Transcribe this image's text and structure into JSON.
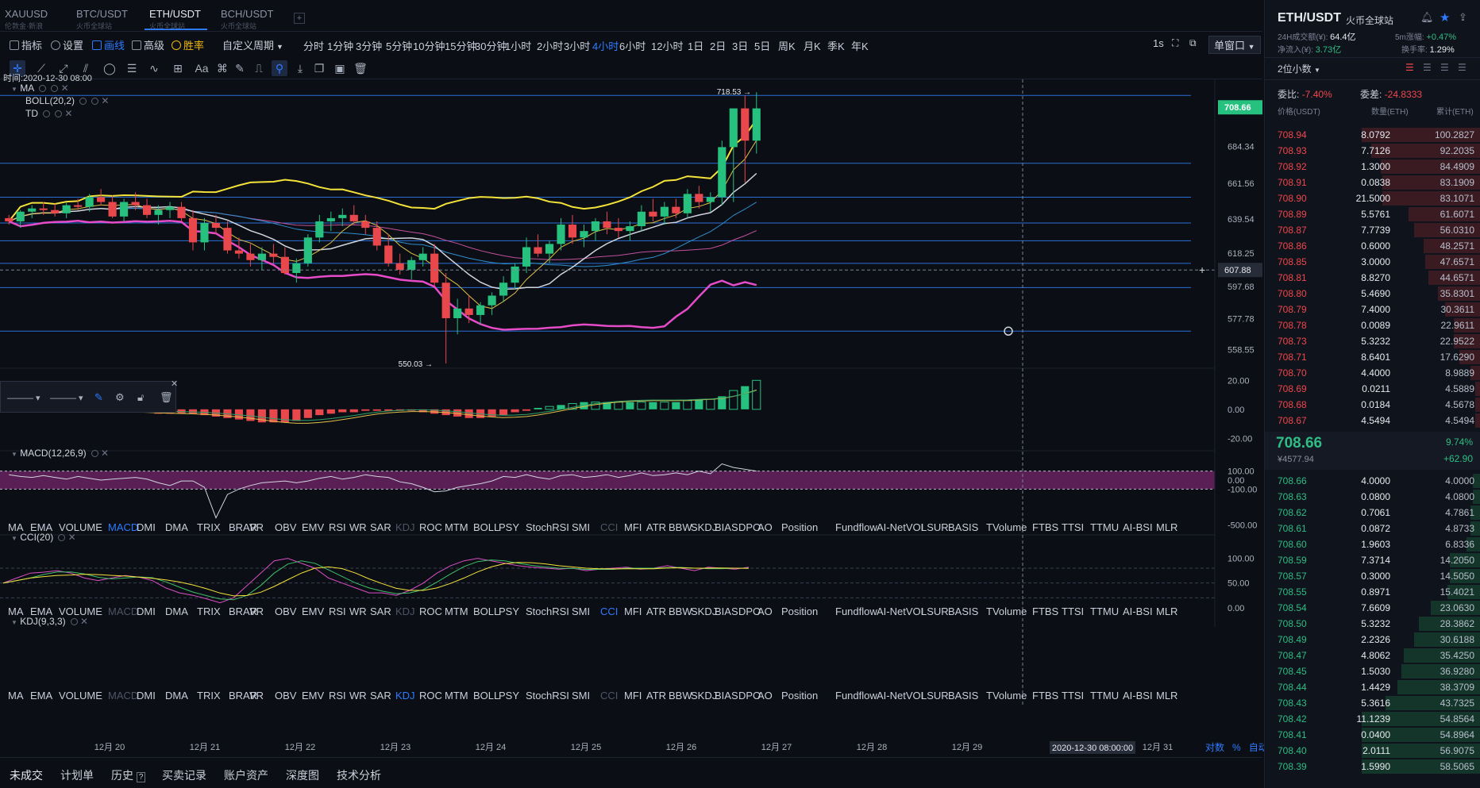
{
  "tabs": [
    {
      "symbol": "XAUUSD",
      "sub": "伦敦金·新浪"
    },
    {
      "symbol": "BTC/USDT",
      "sub": "火币全球站"
    },
    {
      "symbol": "ETH/USDT",
      "sub": "火币全球站"
    },
    {
      "symbol": "BCH/USDT",
      "sub": "火币全球站"
    }
  ],
  "active_tab": 2,
  "toolbar": {
    "items": [
      "指标",
      "设置",
      "画线",
      "高级",
      "胜率"
    ],
    "custom_period": "自定义周期",
    "periods": [
      "分时",
      "1分钟",
      "3分钟",
      "5分钟",
      "10分钟",
      "15分钟",
      "30分钟",
      "1小时",
      "2小时",
      "3小时",
      "4小时",
      "6小时",
      "12小时",
      "1日",
      "2日",
      "3日",
      "5日",
      "周K",
      "月K",
      "季K",
      "年K"
    ],
    "active_period": "4小时",
    "interval": "1s",
    "window_mode": "单窗口"
  },
  "drawing_tools": [
    "crosshair",
    "line-icon",
    "ray-icon",
    "parallel-icon",
    "ellipse-icon",
    "fib-icon",
    "wave-icon",
    "grid-icon",
    "text-icon",
    "brush-icon",
    "ruler-icon",
    "magnet-icon",
    "measure-icon",
    "lock-icon",
    "copy-icon",
    "screenshot-icon",
    "trash-icon"
  ],
  "crosshair_time": "时间:2020-12-30 08:00",
  "main_legends": [
    "MA",
    "BOLL(20,2)",
    "TD"
  ],
  "macd_legend": "MACD(12,26,9)",
  "cci_legend": "CCI(20)",
  "kdj_legend": "KDJ(9,3,3)",
  "indicator_list": [
    "MA",
    "EMA",
    "VOLUME",
    "MACD",
    "DMI",
    "DMA",
    "TRIX",
    "BRAR",
    "VR",
    "OBV",
    "EMV",
    "RSI",
    "WR",
    "SAR",
    "KDJ",
    "ROC",
    "MTM",
    "BOLL",
    "PSY",
    "StochRSI",
    "SMI",
    "CCI",
    "MFI",
    "ATR",
    "BBW",
    "SKDJ",
    "BIAS",
    "DPO",
    "AO",
    "Position",
    "Fundflow",
    "AI-NetVOL",
    "LSUR",
    "BASIS",
    "TVolume",
    "FTBS",
    "TTSI",
    "TTMU",
    "AI-BSI",
    "MLR"
  ],
  "bottom_tabs": [
    "未成交",
    "计划单",
    "历史",
    "买卖记录",
    "账户资产",
    "深度图",
    "技术分析"
  ],
  "axis_modes": [
    "对数",
    "%",
    "自动"
  ],
  "chart_data": [
    {
      "type": "candlestick",
      "name": "ETH/USDT 4小时",
      "x_labels": [
        "12月 20",
        "12月 21",
        "12月 22",
        "12月 23",
        "12月 24",
        "12月 25",
        "12月 26",
        "12月 27",
        "12月 28",
        "12月 29",
        "12月 30",
        "12月 31"
      ],
      "crosshair_x_label": "2020-12-30 08:00:00",
      "y_ticks": [
        708.66,
        684.34,
        661.56,
        639.54,
        618.25,
        597.68,
        577.78,
        558.55
      ],
      "ylim": [
        548,
        725
      ],
      "last_price": 708.66,
      "crosshair_price": 607.88,
      "annotations": [
        {
          "label": "718.53",
          "value": 718.53
        },
        {
          "label": "550.03",
          "value": 550.03
        }
      ],
      "horizontal_levels": [
        716,
        674,
        653,
        637,
        626,
        612,
        597,
        570
      ],
      "ohlc": [
        [
          640,
          642,
          636,
          638
        ],
        [
          638,
          645,
          634,
          644
        ],
        [
          644,
          648,
          640,
          646
        ],
        [
          646,
          650,
          642,
          645
        ],
        [
          645,
          649,
          641,
          643
        ],
        [
          643,
          650,
          640,
          648
        ],
        [
          648,
          652,
          645,
          647
        ],
        [
          647,
          655,
          644,
          653
        ],
        [
          653,
          658,
          648,
          650
        ],
        [
          650,
          654,
          640,
          641
        ],
        [
          641,
          652,
          638,
          650
        ],
        [
          650,
          656,
          645,
          648
        ],
        [
          648,
          652,
          640,
          642
        ],
        [
          642,
          648,
          636,
          645
        ],
        [
          645,
          650,
          640,
          647
        ],
        [
          647,
          650,
          638,
          640
        ],
        [
          640,
          645,
          620,
          625
        ],
        [
          625,
          640,
          620,
          637
        ],
        [
          637,
          642,
          630,
          634
        ],
        [
          634,
          638,
          618,
          620
        ],
        [
          620,
          628,
          615,
          618
        ],
        [
          618,
          624,
          610,
          614
        ],
        [
          614,
          622,
          608,
          618
        ],
        [
          618,
          624,
          612,
          616
        ],
        [
          616,
          622,
          605,
          606
        ],
        [
          606,
          615,
          600,
          612
        ],
        [
          612,
          630,
          610,
          628
        ],
        [
          628,
          642,
          625,
          638
        ],
        [
          638,
          644,
          632,
          640
        ],
        [
          640,
          646,
          635,
          642
        ],
        [
          642,
          648,
          636,
          638
        ],
        [
          638,
          642,
          630,
          634
        ],
        [
          634,
          638,
          620,
          623
        ],
        [
          623,
          630,
          610,
          612
        ],
        [
          612,
          618,
          605,
          608
        ],
        [
          608,
          616,
          602,
          614
        ],
        [
          614,
          622,
          610,
          618
        ],
        [
          618,
          624,
          598,
          600
        ],
        [
          600,
          606,
          550,
          578
        ],
        [
          578,
          590,
          568,
          584
        ],
        [
          584,
          592,
          575,
          580
        ],
        [
          580,
          588,
          574,
          586
        ],
        [
          586,
          594,
          580,
          592
        ],
        [
          592,
          604,
          588,
          600
        ],
        [
          600,
          612,
          596,
          610
        ],
        [
          610,
          628,
          606,
          622
        ],
        [
          622,
          630,
          616,
          618
        ],
        [
          618,
          626,
          612,
          624
        ],
        [
          624,
          640,
          620,
          636
        ],
        [
          636,
          642,
          624,
          628
        ],
        [
          628,
          636,
          622,
          632
        ],
        [
          632,
          640,
          626,
          638
        ],
        [
          638,
          644,
          630,
          634
        ],
        [
          634,
          640,
          628,
          632
        ],
        [
          632,
          638,
          626,
          635
        ],
        [
          635,
          648,
          632,
          644
        ],
        [
          644,
          652,
          638,
          641
        ],
        [
          641,
          650,
          636,
          647
        ],
        [
          647,
          652,
          640,
          643
        ],
        [
          643,
          658,
          640,
          655
        ],
        [
          655,
          660,
          646,
          650
        ],
        [
          650,
          656,
          644,
          653
        ],
        [
          653,
          688,
          648,
          684
        ],
        [
          684,
          702,
          650,
          708
        ],
        [
          708,
          716,
          662,
          688
        ],
        [
          688,
          718,
          680,
          708
        ]
      ]
    },
    {
      "type": "bar",
      "name": "MACD(12,26,9)",
      "y_ticks": [
        20.0,
        0.0,
        -20.0
      ],
      "ylim": [
        -22,
        24
      ],
      "histogram": [
        -1,
        -1,
        -1,
        -1,
        -1,
        -1,
        -1,
        -1,
        -2,
        -2,
        -2,
        -2,
        -2,
        -3,
        -3,
        -3,
        -3,
        -4,
        -5,
        -6,
        -7,
        -8,
        -9,
        -9,
        -9,
        -8,
        -6,
        -4,
        -3,
        -2,
        -2,
        -1,
        -1,
        -1,
        -1,
        -1,
        -2,
        -3,
        -4,
        -5,
        -6,
        -6,
        -5,
        -4,
        -2,
        -1,
        1,
        2,
        3,
        4,
        5,
        5,
        5,
        5,
        5,
        5,
        5,
        5,
        5,
        6,
        7,
        7,
        9,
        13,
        16,
        20
      ]
    },
    {
      "type": "line",
      "name": "CCI(20)",
      "y_ticks": [
        100.0,
        0.0,
        -100.0,
        -500.0
      ],
      "ylim": [
        -520,
        220
      ],
      "values": [
        60,
        40,
        30,
        50,
        30,
        10,
        40,
        20,
        0,
        10,
        20,
        30,
        10,
        -30,
        -60,
        -10,
        -10,
        -80,
        -420,
        -160,
        -100,
        -60,
        -30,
        -20,
        -10,
        -30,
        -10,
        20,
        40,
        10,
        30,
        60,
        40,
        30,
        -20,
        -40,
        -80,
        -130,
        -120,
        -80,
        -60,
        -40,
        -10,
        40,
        30,
        60,
        30,
        10,
        50,
        60,
        30,
        40,
        60,
        30,
        50,
        80,
        50,
        60,
        80,
        60,
        100,
        70,
        180,
        140,
        120,
        100
      ]
    },
    {
      "type": "line",
      "name": "KDJ(9,3,3)",
      "y_ticks": [
        100.0,
        50.0,
        0.0
      ],
      "ylim": [
        -10,
        125
      ],
      "values": [
        50,
        60,
        70,
        72,
        75,
        70,
        60,
        55,
        60,
        65,
        62,
        55,
        40,
        30,
        25,
        18,
        10,
        20,
        45,
        70,
        95,
        100,
        90,
        80,
        60,
        50,
        40,
        30,
        30,
        25,
        35,
        50,
        70,
        85,
        95,
        100,
        95,
        90,
        85,
        82,
        80,
        78,
        80,
        75,
        78,
        80,
        82,
        78,
        80,
        85,
        80,
        75,
        82,
        80,
        78,
        82
      ]
    }
  ],
  "right": {
    "symbol": "ETH/USDT",
    "exchange": "火币全球站",
    "vol_label": "24H成交额(¥):",
    "vol_value": "64.4亿",
    "chg5m_label": "5m涨幅:",
    "chg5m_value": "+0.47%",
    "netin_label": "净流入(¥):",
    "netin_value": "3.73亿",
    "turnover_label": "换手率:",
    "turnover_value": "1.29%",
    "precision": "2位小数",
    "ratio_label": "委比:",
    "ratio_value": "-7.40%",
    "diff_label": "委差:",
    "diff_value": "-24.8333",
    "col_price": "价格(USDT)",
    "col_qty": "数量(ETH)",
    "col_cum": "累计(ETH)",
    "asks": [
      {
        "p": "708.94",
        "q": "8.0792",
        "c": "100.2827",
        "d": 1.0
      },
      {
        "p": "708.93",
        "q": "7.7126",
        "c": "92.2035",
        "d": 0.92
      },
      {
        "p": "708.92",
        "q": "1.3000",
        "c": "84.4909",
        "d": 0.84
      },
      {
        "p": "708.91",
        "q": "0.0838",
        "c": "83.1909",
        "d": 0.83
      },
      {
        "p": "708.90",
        "q": "21.5000",
        "c": "83.1071",
        "d": 0.83
      },
      {
        "p": "708.89",
        "q": "5.5761",
        "c": "61.6071",
        "d": 0.61
      },
      {
        "p": "708.87",
        "q": "7.7739",
        "c": "56.0310",
        "d": 0.56
      },
      {
        "p": "708.86",
        "q": "0.6000",
        "c": "48.2571",
        "d": 0.48
      },
      {
        "p": "708.85",
        "q": "3.0000",
        "c": "47.6571",
        "d": 0.47
      },
      {
        "p": "708.81",
        "q": "8.8270",
        "c": "44.6571",
        "d": 0.44
      },
      {
        "p": "708.80",
        "q": "5.4690",
        "c": "35.8301",
        "d": 0.36
      },
      {
        "p": "708.79",
        "q": "7.4000",
        "c": "30.3611",
        "d": 0.3
      },
      {
        "p": "708.78",
        "q": "0.0089",
        "c": "22.9611",
        "d": 0.23
      },
      {
        "p": "708.73",
        "q": "5.3232",
        "c": "22.9522",
        "d": 0.23
      },
      {
        "p": "708.71",
        "q": "8.6401",
        "c": "17.6290",
        "d": 0.18
      },
      {
        "p": "708.70",
        "q": "4.4000",
        "c": "8.9889",
        "d": 0.09
      },
      {
        "p": "708.69",
        "q": "0.0211",
        "c": "4.5889",
        "d": 0.05
      },
      {
        "p": "708.68",
        "q": "0.0184",
        "c": "4.5678",
        "d": 0.05
      },
      {
        "p": "708.67",
        "q": "4.5494",
        "c": "4.5494",
        "d": 0.05
      }
    ],
    "last": "708.66",
    "last_cny": "¥4577.94",
    "last_pct": "9.74%",
    "last_chg": "+62.90",
    "bids": [
      {
        "p": "708.66",
        "q": "4.0000",
        "c": "4.0000",
        "d": 0.07
      },
      {
        "p": "708.63",
        "q": "0.0800",
        "c": "4.0800",
        "d": 0.07
      },
      {
        "p": "708.62",
        "q": "0.7061",
        "c": "4.7861",
        "d": 0.09
      },
      {
        "p": "708.61",
        "q": "0.0872",
        "c": "4.8733",
        "d": 0.09
      },
      {
        "p": "708.60",
        "q": "1.9603",
        "c": "6.8336",
        "d": 0.12
      },
      {
        "p": "708.59",
        "q": "7.3714",
        "c": "14.2050",
        "d": 0.26
      },
      {
        "p": "708.57",
        "q": "0.3000",
        "c": "14.5050",
        "d": 0.26
      },
      {
        "p": "708.55",
        "q": "0.8971",
        "c": "15.4021",
        "d": 0.28
      },
      {
        "p": "708.54",
        "q": "7.6609",
        "c": "23.0630",
        "d": 0.42
      },
      {
        "p": "708.50",
        "q": "5.3232",
        "c": "28.3862",
        "d": 0.52
      },
      {
        "p": "708.49",
        "q": "2.2326",
        "c": "30.6188",
        "d": 0.56
      },
      {
        "p": "708.47",
        "q": "4.8062",
        "c": "35.4250",
        "d": 0.65
      },
      {
        "p": "708.45",
        "q": "1.5030",
        "c": "36.9280",
        "d": 0.67
      },
      {
        "p": "708.44",
        "q": "1.4429",
        "c": "38.3709",
        "d": 0.7
      },
      {
        "p": "708.43",
        "q": "5.3616",
        "c": "43.7325",
        "d": 0.8
      },
      {
        "p": "708.42",
        "q": "11.1239",
        "c": "54.8564",
        "d": 1.0
      },
      {
        "p": "708.41",
        "q": "0.0400",
        "c": "54.8964",
        "d": 1.0
      },
      {
        "p": "708.40",
        "q": "2.0111",
        "c": "56.9075",
        "d": 1.0
      },
      {
        "p": "708.39",
        "q": "1.5990",
        "c": "58.5065",
        "d": 1.0
      }
    ]
  }
}
